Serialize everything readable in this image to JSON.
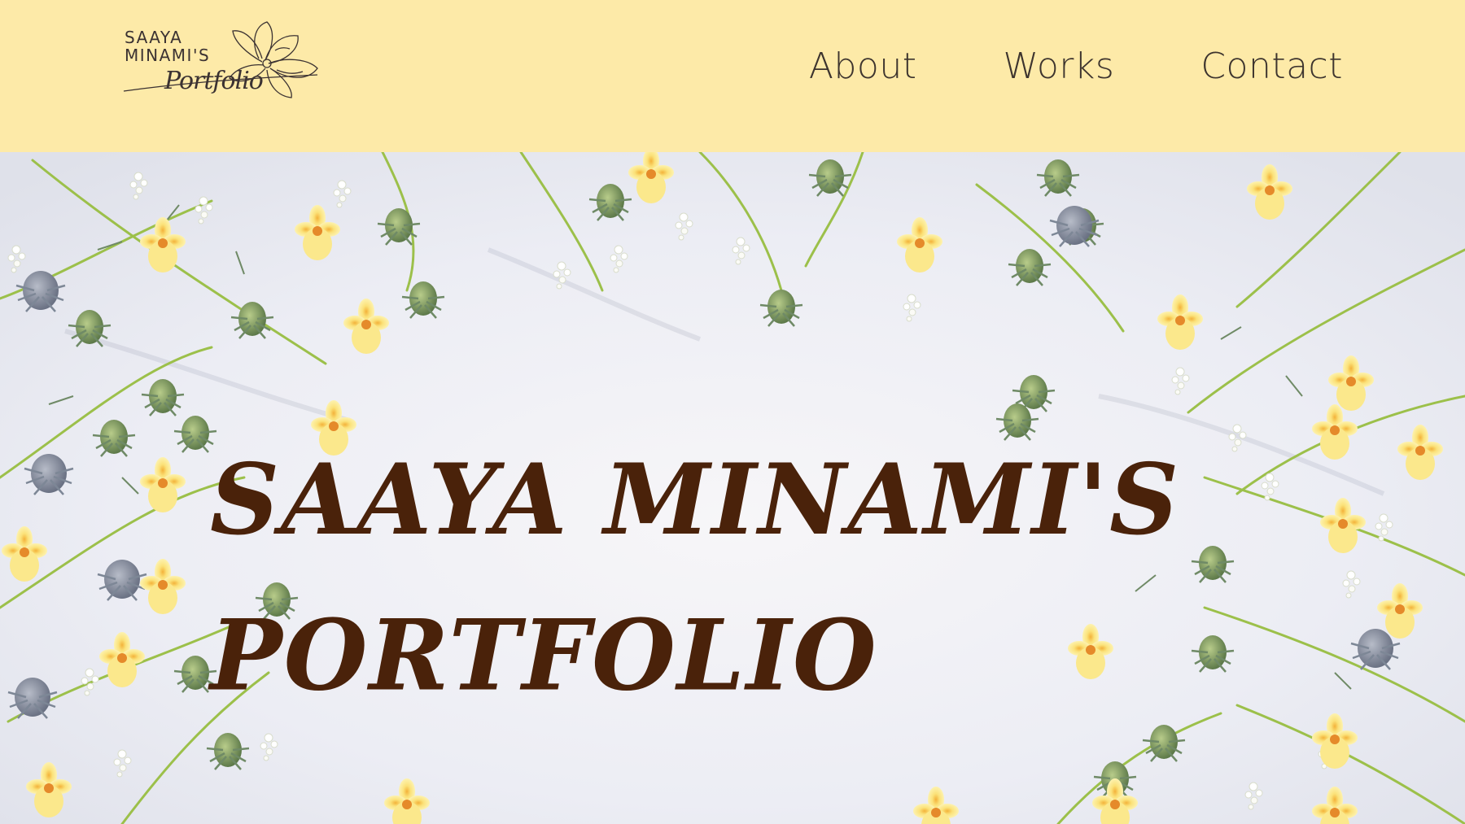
{
  "header": {
    "logo": {
      "line1": "SAAYA",
      "line2": "MINAMI'S",
      "script": "Portfolio"
    },
    "nav": [
      {
        "label": "About"
      },
      {
        "label": "Works"
      },
      {
        "label": "Contact"
      }
    ],
    "background_color": "#fdeaa8"
  },
  "hero": {
    "title_line1": "SAAYA MINAMI'S",
    "title_line2": "PORTFOLIO",
    "title_color": "#4a220a",
    "image": "flat-lay-of-yellow-orchids-white-flowers-and-eryngium-thistles"
  }
}
